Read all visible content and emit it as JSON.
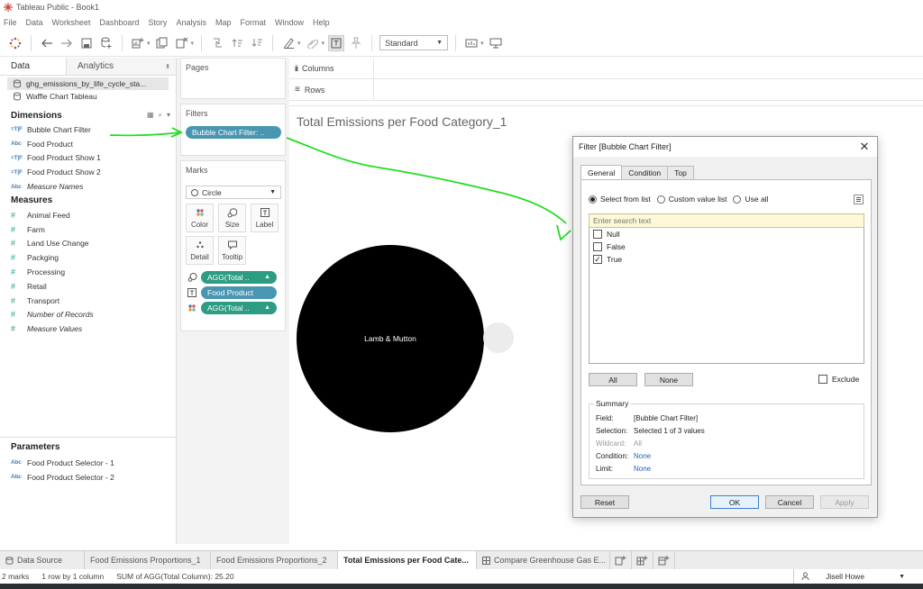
{
  "window": {
    "title": "Tableau Public - Book1"
  },
  "menu": [
    "File",
    "Data",
    "Worksheet",
    "Dashboard",
    "Story",
    "Analysis",
    "Map",
    "Format",
    "Window",
    "Help"
  ],
  "toolbar": {
    "mark_type_dropdown": "Standard"
  },
  "data_pane": {
    "tabs": {
      "data": "Data",
      "analytics": "Analytics"
    },
    "datasources": [
      "ghg_emissions_by_life_cycle_sta...",
      "Waffle Chart Tableau"
    ],
    "dimensions_title": "Dimensions",
    "dimensions": [
      {
        "type": "=T|F",
        "name": "Bubble Chart Filter"
      },
      {
        "type": "Abc",
        "name": "Food Product"
      },
      {
        "type": "=T|F",
        "name": "Food Product Show 1"
      },
      {
        "type": "=T|F",
        "name": "Food Product Show 2"
      },
      {
        "type": "Abc",
        "name": "Measure Names"
      }
    ],
    "measures_title": "Measures",
    "measures": [
      {
        "type": "#",
        "name": "Animal Feed"
      },
      {
        "type": "#",
        "name": "Farm"
      },
      {
        "type": "#",
        "name": "Land Use Change"
      },
      {
        "type": "#",
        "name": "Packging"
      },
      {
        "type": "#",
        "name": "Processing"
      },
      {
        "type": "#",
        "name": "Retail"
      },
      {
        "type": "#",
        "name": "Transport"
      },
      {
        "type": "#",
        "name": "Number of Records"
      },
      {
        "type": "#",
        "name": "Measure Values"
      }
    ],
    "parameters_title": "Parameters",
    "parameters": [
      {
        "type": "Abc",
        "name": "Food Product Selector - 1"
      },
      {
        "type": "Abc",
        "name": "Food Product Selector - 2"
      }
    ]
  },
  "shelves": {
    "pages": "Pages",
    "filters": "Filters",
    "filter_pill": "Bubble Chart Filter: ..",
    "marks": "Marks",
    "mark_type": "Circle",
    "mark_buttons": {
      "color": "Color",
      "size": "Size",
      "label": "Label",
      "detail": "Detail",
      "tooltip": "Tooltip"
    },
    "mark_pills": [
      "AGG(Total ..",
      "Food Product",
      "AGG(Total .."
    ],
    "columns": "Columns",
    "rows": "Rows"
  },
  "view": {
    "sheet_title": "Total Emissions per Food Category_1",
    "bubbles": [
      {
        "label": "Lamb & Mutton",
        "color": "#000000"
      },
      {
        "label": "",
        "color": "#ececec"
      }
    ]
  },
  "filter_dialog": {
    "title": "Filter [Bubble Chart Filter]",
    "tabs": [
      "General",
      "Condition",
      "Top"
    ],
    "radio_options": [
      "Select from list",
      "Custom value list",
      "Use all"
    ],
    "search_placeholder": "Enter search text",
    "values": [
      {
        "label": "Null",
        "checked": false
      },
      {
        "label": "False",
        "checked": false
      },
      {
        "label": "True",
        "checked": true
      }
    ],
    "all_button": "All",
    "none_button": "None",
    "exclude_label": "Exclude",
    "summary": {
      "title": "Summary",
      "field_label": "Field:",
      "field_value": "[Bubble Chart Filter]",
      "selection_label": "Selection:",
      "selection_value": "Selected 1 of 3 values",
      "wildcard_label": "Wildcard:",
      "wildcard_value": "All",
      "condition_label": "Condition:",
      "condition_value": "None",
      "limit_label": "Limit:",
      "limit_value": "None"
    },
    "buttons": {
      "reset": "Reset",
      "ok": "OK",
      "cancel": "Cancel",
      "apply": "Apply"
    }
  },
  "sheet_tabs": [
    {
      "label": "Data Source",
      "active": false
    },
    {
      "label": "Food Emissions Proportions_1",
      "active": false
    },
    {
      "label": "Food Emissions Proportions_2",
      "active": false
    },
    {
      "label": "Total Emissions per Food Cate...",
      "active": true
    },
    {
      "label": "Compare Greenhouse Gas E...",
      "active": false
    }
  ],
  "status": {
    "marks": "2 marks",
    "rows_cols": "1 row by 1 column",
    "sum": "SUM of AGG(Total Column): 25.20",
    "user": "Jisell Howe"
  },
  "colors": {
    "accent_pill": "#4996b2",
    "measure_pill": "#2c9c82",
    "annotation": "#22dd22"
  }
}
